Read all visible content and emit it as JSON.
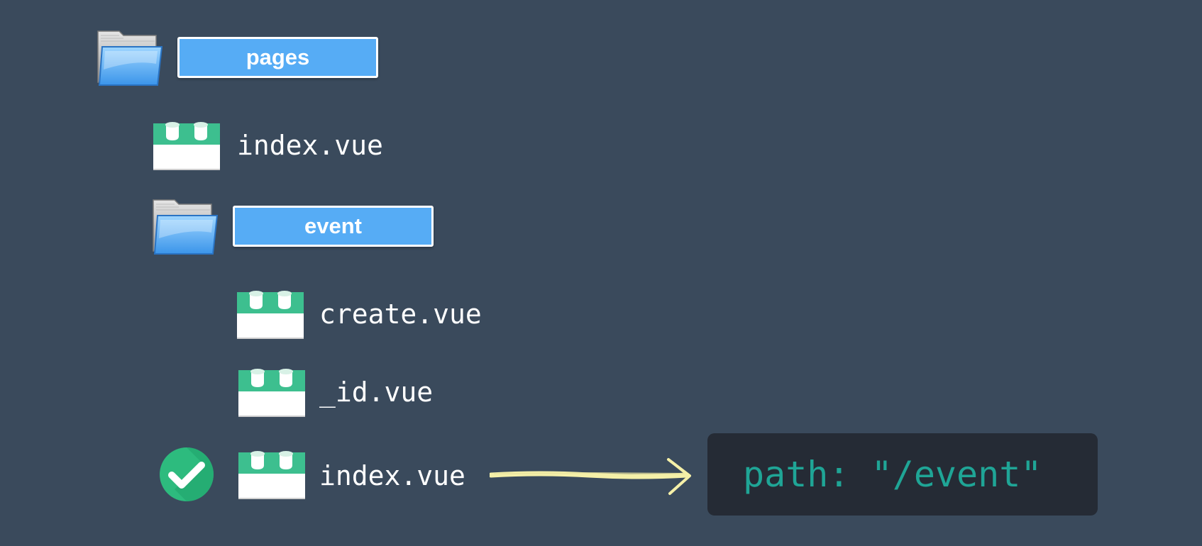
{
  "tree": {
    "root_folder": {
      "label": "pages"
    },
    "root_index": {
      "label": "index.vue"
    },
    "sub_folder": {
      "label": "event"
    },
    "files": [
      {
        "label": "create.vue"
      },
      {
        "label": "_id.vue"
      },
      {
        "label": "index.vue",
        "selected": true
      }
    ]
  },
  "route": {
    "code": "path: \"/event\""
  },
  "colors": {
    "background": "#3a4a5c",
    "folder_label": "#56acf5",
    "vue_green": "#3dbf8f",
    "code_box": "#252b35",
    "code_text": "#1fa596",
    "arrow": "#f5f0a8",
    "check": "#2dbb7e"
  },
  "icons": {
    "folder": "folder-icon",
    "vue_file": "vue-file-icon",
    "check": "check-circle-icon",
    "arrow": "arrow-right-icon"
  }
}
